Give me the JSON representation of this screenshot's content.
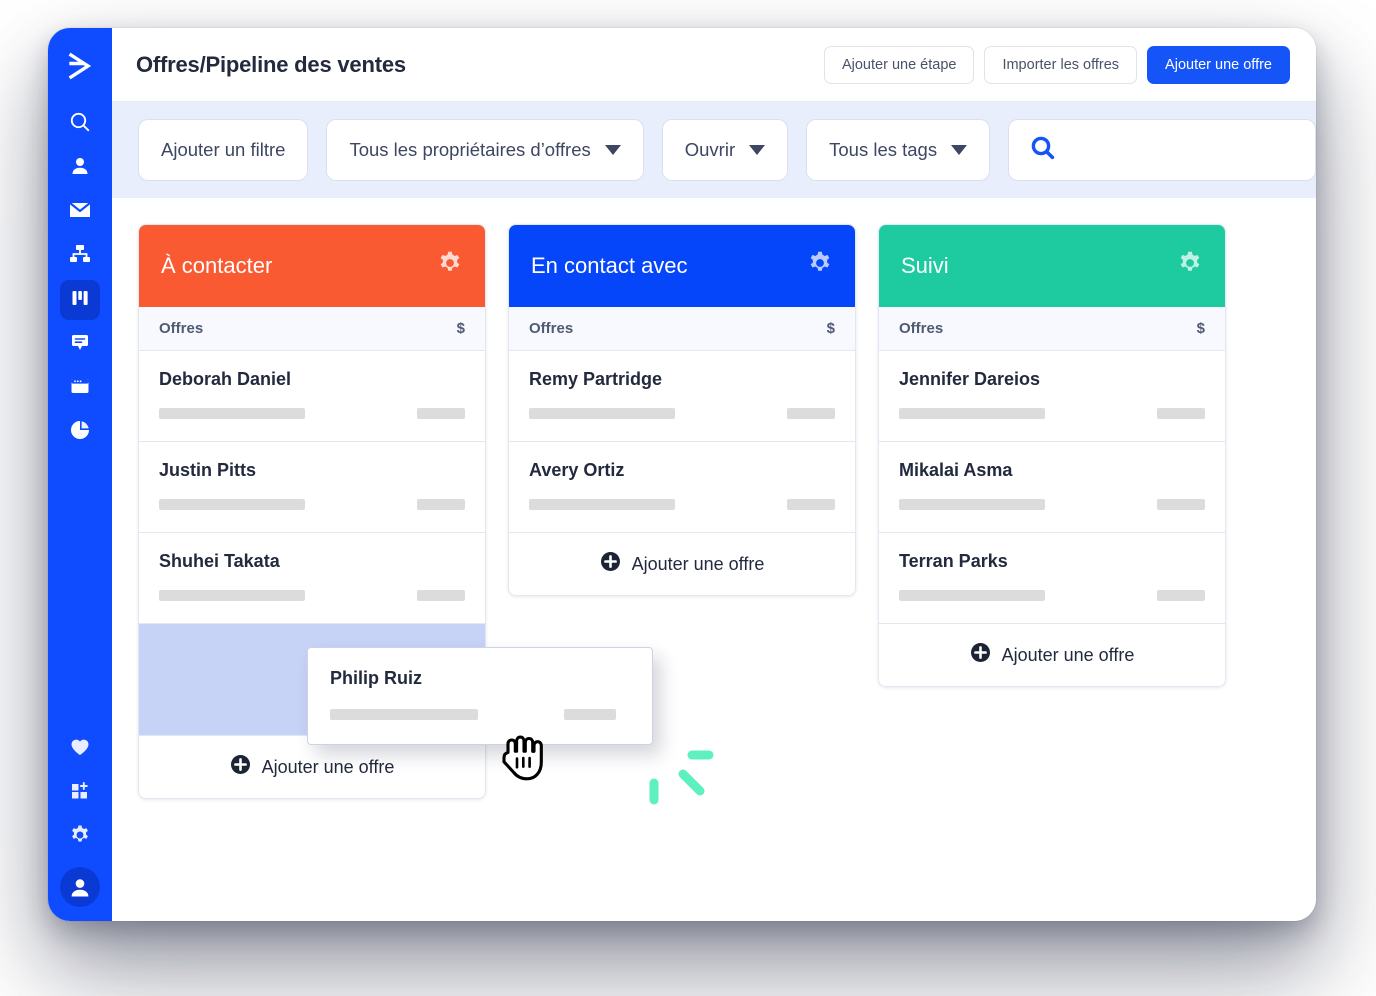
{
  "app": {
    "accent_blue": "#1554f6",
    "sidebar_blue": "#0f4bff",
    "sidebar_active": "#0b39d4"
  },
  "sidebar": {
    "logo": "send-arrow-logo",
    "items": [
      {
        "icon": "search-icon",
        "name": "search",
        "active": false
      },
      {
        "icon": "person-icon",
        "name": "contacts",
        "active": false
      },
      {
        "icon": "envelope-icon",
        "name": "mail",
        "active": false
      },
      {
        "icon": "org-chart-icon",
        "name": "workflow",
        "active": false
      },
      {
        "icon": "kanban-icon",
        "name": "deals",
        "active": true
      },
      {
        "icon": "chat-icon",
        "name": "chat",
        "active": false
      },
      {
        "icon": "window-icon",
        "name": "pages",
        "active": false
      },
      {
        "icon": "pie-chart-icon",
        "name": "reports",
        "active": false
      }
    ],
    "bottom_items": [
      {
        "icon": "heart-icon",
        "name": "favorites"
      },
      {
        "icon": "apps-add-icon",
        "name": "apps"
      },
      {
        "icon": "gear-icon",
        "name": "settings"
      }
    ],
    "avatar": "user-avatar"
  },
  "header": {
    "title": "Offres/Pipeline des ventes",
    "buttons": [
      {
        "label": "Ajouter une étape",
        "style": "ghost"
      },
      {
        "label": "Importer les offres",
        "style": "ghost"
      },
      {
        "label": "Ajouter une offre",
        "style": "primary"
      }
    ]
  },
  "filters": {
    "add_filter_label": "Ajouter un filtre",
    "owner_label": "Tous les propriétaires d’offres",
    "status_label": "Ouvrir",
    "tags_label": "Tous les tags",
    "search": {
      "value": "",
      "placeholder": ""
    }
  },
  "board": {
    "sub_header": {
      "deals": "Offres",
      "amount": "$"
    },
    "add_deal_label": "Ajouter une offre",
    "columns": [
      {
        "title": "À contacter",
        "color": "#fa5a32",
        "gear": "gear-icon",
        "cards": [
          {
            "name": "Deborah Daniel"
          },
          {
            "name": "Justin Pitts"
          },
          {
            "name": "Shuhei Takata"
          }
        ],
        "has_drop_zone": true
      },
      {
        "title": "En contact avec",
        "color": "#0546fb",
        "gear": "gear-icon",
        "cards": [
          {
            "name": "Remy Partridge"
          },
          {
            "name": "Avery Ortiz"
          }
        ],
        "has_drop_zone": false
      },
      {
        "title": "Suivi",
        "color": "#1ecba0",
        "gear": "gear-icon",
        "cards": [
          {
            "name": "Jennifer Dareios"
          },
          {
            "name": "Mikalai Asma"
          },
          {
            "name": "Terran Parks"
          }
        ],
        "has_drop_zone": false
      }
    ]
  },
  "drag": {
    "card_name": "Philip Ruiz",
    "cursor": "grabbing-hand-cursor",
    "motion_color": "#5ff0c0"
  }
}
